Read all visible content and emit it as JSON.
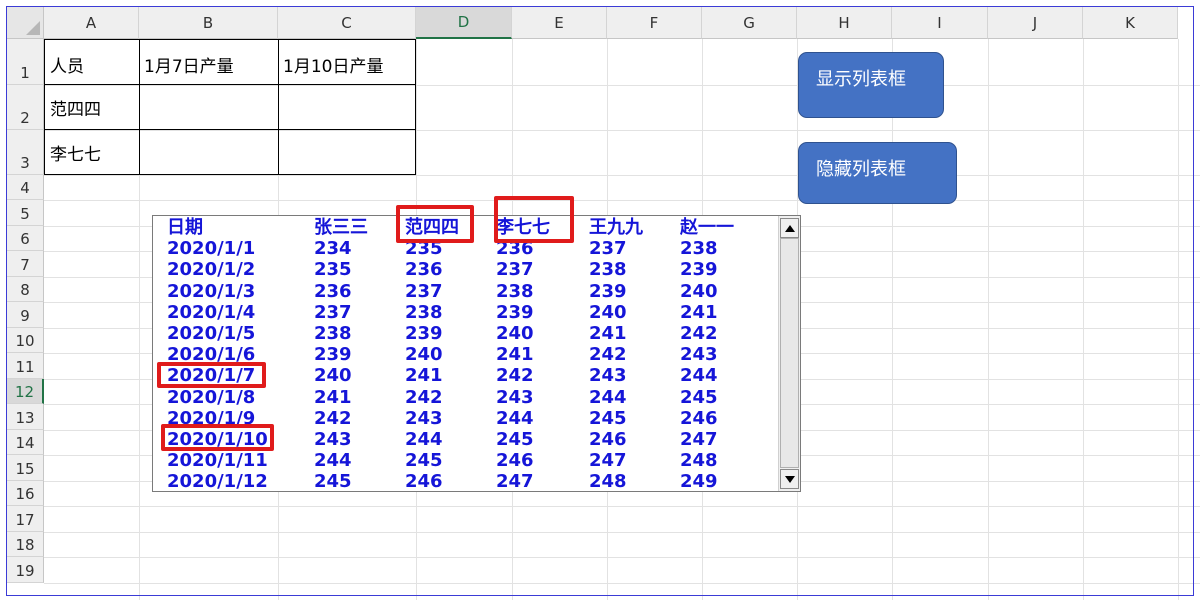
{
  "columns": [
    "A",
    "B",
    "C",
    "D",
    "E",
    "F",
    "G",
    "H",
    "I",
    "J",
    "K"
  ],
  "selected_column": "D",
  "rows": [
    "1",
    "2",
    "3",
    "4",
    "5",
    "6",
    "7",
    "8",
    "9",
    "10",
    "11",
    "12",
    "13",
    "14",
    "15",
    "16",
    "17",
    "18",
    "19"
  ],
  "selected_row": "12",
  "sheet_table": {
    "header": [
      "人员",
      "1月7日产量",
      "1月10日产量"
    ],
    "rows": [
      [
        "范四四",
        "",
        ""
      ],
      [
        "李七七",
        "",
        ""
      ]
    ]
  },
  "buttons": {
    "show_label": "显示列表框",
    "hide_label": "隐藏列表框"
  },
  "listbox": {
    "headers": [
      "日期",
      "张三三",
      "范四四",
      "李七七",
      "王九九",
      "赵一一"
    ],
    "rows": [
      [
        "2020/1/1",
        "234",
        "235",
        "236",
        "237",
        "238"
      ],
      [
        "2020/1/2",
        "235",
        "236",
        "237",
        "238",
        "239"
      ],
      [
        "2020/1/3",
        "236",
        "237",
        "238",
        "239",
        "240"
      ],
      [
        "2020/1/4",
        "237",
        "238",
        "239",
        "240",
        "241"
      ],
      [
        "2020/1/5",
        "238",
        "239",
        "240",
        "241",
        "242"
      ],
      [
        "2020/1/6",
        "239",
        "240",
        "241",
        "242",
        "243"
      ],
      [
        "2020/1/7",
        "240",
        "241",
        "242",
        "243",
        "244"
      ],
      [
        "2020/1/8",
        "241",
        "242",
        "243",
        "244",
        "245"
      ],
      [
        "2020/1/9",
        "242",
        "243",
        "244",
        "245",
        "246"
      ],
      [
        "2020/1/10",
        "243",
        "244",
        "245",
        "246",
        "247"
      ],
      [
        "2020/1/11",
        "244",
        "245",
        "246",
        "247",
        "248"
      ],
      [
        "2020/1/12",
        "245",
        "246",
        "247",
        "248",
        "249"
      ]
    ],
    "scroll_up_icon": "triangle-up",
    "scroll_down_icon": "triangle-down"
  },
  "colors": {
    "listbox_text": "#1515d8",
    "button_fill": "#4472c4",
    "highlight_box": "#e01b1b",
    "selection_green": "#217346"
  }
}
